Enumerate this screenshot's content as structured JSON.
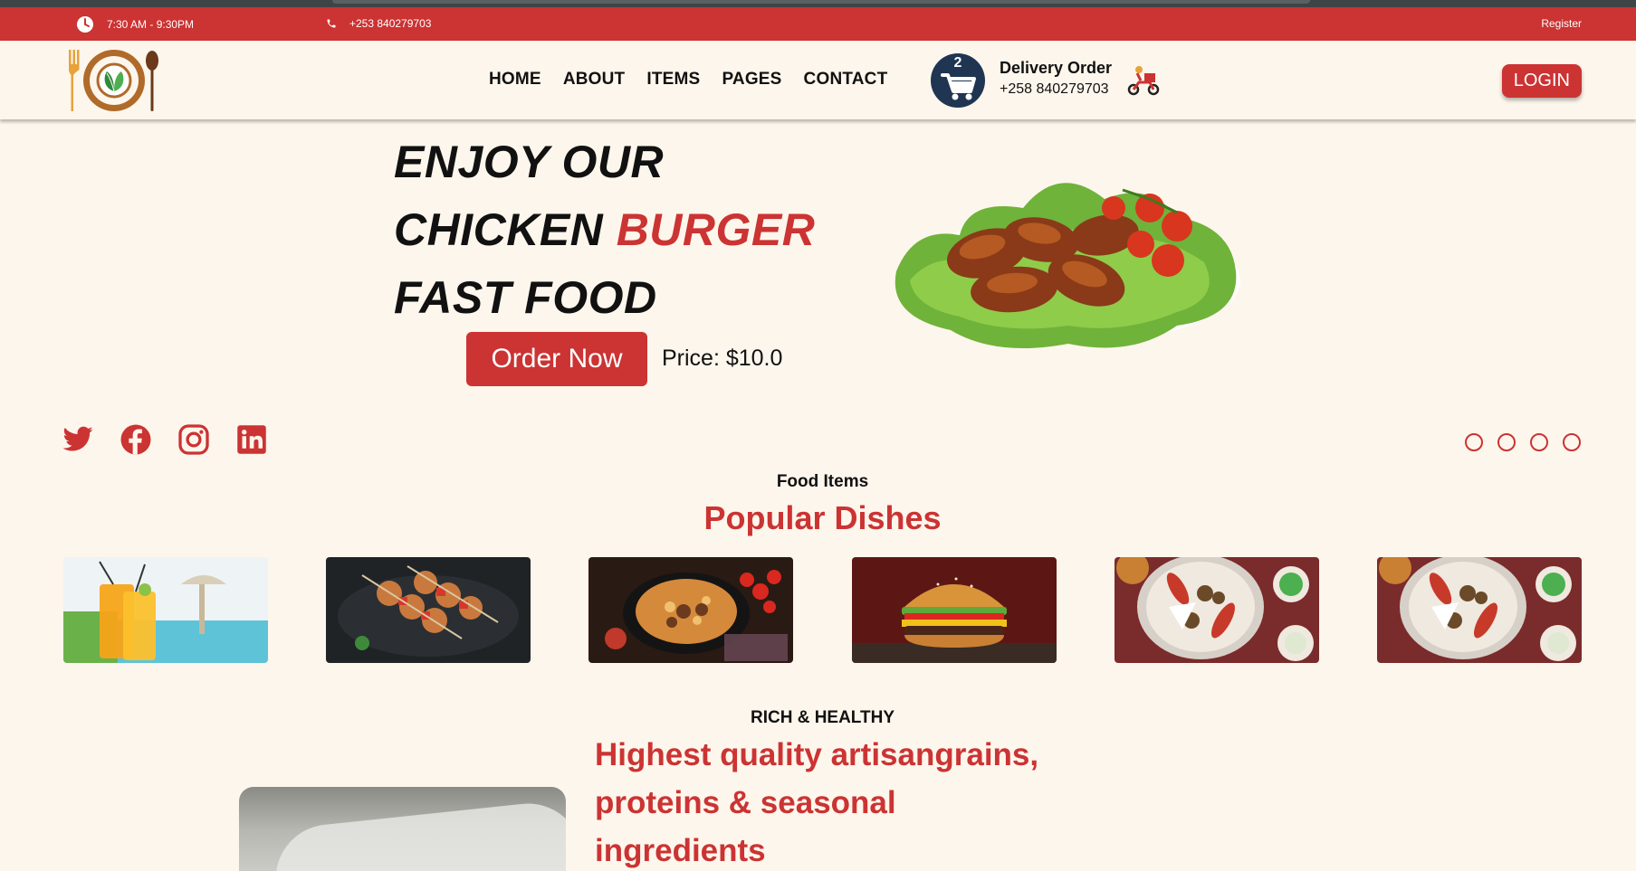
{
  "topbar": {
    "hours": "7:30 AM - 9:30PM",
    "phone": "+253 840279703",
    "register": "Register"
  },
  "nav": {
    "items": [
      "HOME",
      "ABOUT",
      "ITEMS",
      "PAGES",
      "CONTACT"
    ],
    "cart_count": "2",
    "delivery_title": "Delivery Order",
    "delivery_phone": "+258 840279703",
    "login": "LOGIN"
  },
  "hero": {
    "line1": "ENJOY OUR",
    "line2_black": "CHICKEN",
    "line2_red": "BURGER",
    "line3": "FAST FOOD",
    "order_button": "Order Now",
    "price": "Price: $10.0"
  },
  "social": [
    "twitter-icon",
    "facebook-icon",
    "instagram-icon",
    "linkedin-icon"
  ],
  "carousel": {
    "dots": 4
  },
  "food_items": {
    "label": "Food Items",
    "title": "Popular Dishes",
    "dishes": [
      "juice",
      "kebab-skewers",
      "rice-pan",
      "burger",
      "mezze-platter",
      "mezze-platter"
    ]
  },
  "healthy": {
    "label": "RICH & HEALTHY",
    "title": "Highest quality artisangrains, proteins & seasonal ingredients"
  },
  "colors": {
    "accent": "#cc3333",
    "background": "#fdf6ec",
    "cart": "#1f3552",
    "topstrip": "#3f4446"
  }
}
